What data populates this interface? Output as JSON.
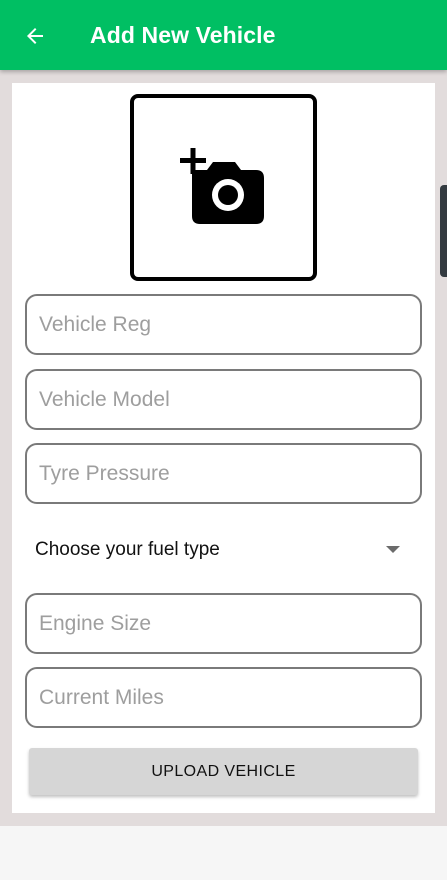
{
  "appbar": {
    "title": "Add New Vehicle",
    "back_icon": "arrow-left-icon",
    "color": "#00bf63"
  },
  "photo": {
    "icon": "add-a-photo-icon"
  },
  "form": {
    "vehicle_reg": {
      "placeholder": "Vehicle Reg",
      "value": ""
    },
    "vehicle_model": {
      "placeholder": "Vehicle Model",
      "value": ""
    },
    "tyre_pressure": {
      "placeholder": "Tyre Pressure",
      "value": ""
    },
    "fuel_type": {
      "selected": "Choose your fuel type"
    },
    "engine_size": {
      "placeholder": "Engine Size",
      "value": ""
    },
    "current_miles": {
      "placeholder": "Current Miles",
      "value": ""
    }
  },
  "upload_button": {
    "label": "UPLOAD VEHICLE"
  }
}
